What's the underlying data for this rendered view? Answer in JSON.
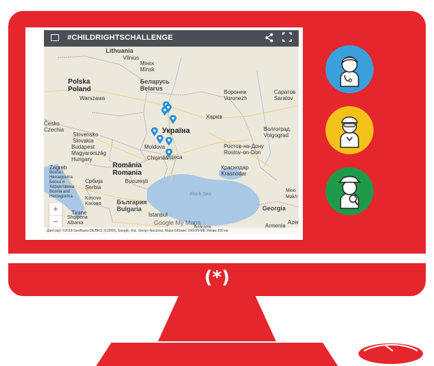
{
  "logo": {
    "text": "(*)"
  },
  "map": {
    "title": "#CHILDRIGHTSCHALLENGE",
    "icons": {
      "menu": "map-menu-icon",
      "share": "share-icon",
      "fullscreen": "fullscreen-icon"
    },
    "labels": {
      "lithuania": "Lithuania",
      "vilnius": "Vilnius",
      "minsk": "Мінск\nMinsk",
      "polska": "Polska",
      "poland": "Poland",
      "warszawa": "Warszawa",
      "belarus": "Беларусь\nBelarus",
      "voronezh": "Воронеж\nVoronezh",
      "saratov": "Саратов\nSaratov",
      "kharkiv": "Харків",
      "ukraina": "Україна",
      "czechia": "Česko\nCzechia",
      "slovakia": "Slovensko\nSlovakia",
      "budapest": "Budapest",
      "hungary": "Magyarország\nHungary",
      "moldova": "Moldova",
      "chisinau": "Chișinău",
      "odesa": "Одеса",
      "volgograd": "Волгоград\nVolgograd",
      "rostov": "Ростов-на-Дону\nRostov-on-Don",
      "krasnodar": "Краснодар\nKrasnodar",
      "romania": "România\nRomania",
      "bucuresti": "București",
      "zagreb": "Zagreb",
      "bosnia": "Bosna i\nHercegovina\nБосна и\nХерцеговина\nBosnia and\nHerzegovina",
      "serbia": "Србија\nSerbia",
      "kosovo": "Kosovo\nKoсово",
      "bulgaria": "България\nBulgaria",
      "albania": "Shqipëria\nAlbania",
      "tirana": "Tirane",
      "black_sea": "Black Sea",
      "istanbul": "İstanbul",
      "ankara": "Ankara",
      "georgia": "Georgia",
      "armenia": "Armenia",
      "azer": "Azer",
      "mexi": "Mexi\nMakh"
    },
    "zoom": {
      "in": "+",
      "out": "−"
    },
    "google_logo": "Google My Maps",
    "footer": "Дані карт ©2018 GeoBasis-DE/BKG (©2009), Google, Inst. Geogr. Nacional, Mapa GISrael, ORION-ME   Умови   200 км",
    "marker_color": "#2a8fd6"
  },
  "avatars": [
    {
      "name": "doctor-avatar",
      "color": "#3aa0dc"
    },
    {
      "name": "worker-avatar",
      "color": "#f3c21a"
    },
    {
      "name": "detective-avatar",
      "color": "#1e9a4b"
    }
  ],
  "colors": {
    "monitor": "#e5262c",
    "screen": "#ffffff"
  }
}
